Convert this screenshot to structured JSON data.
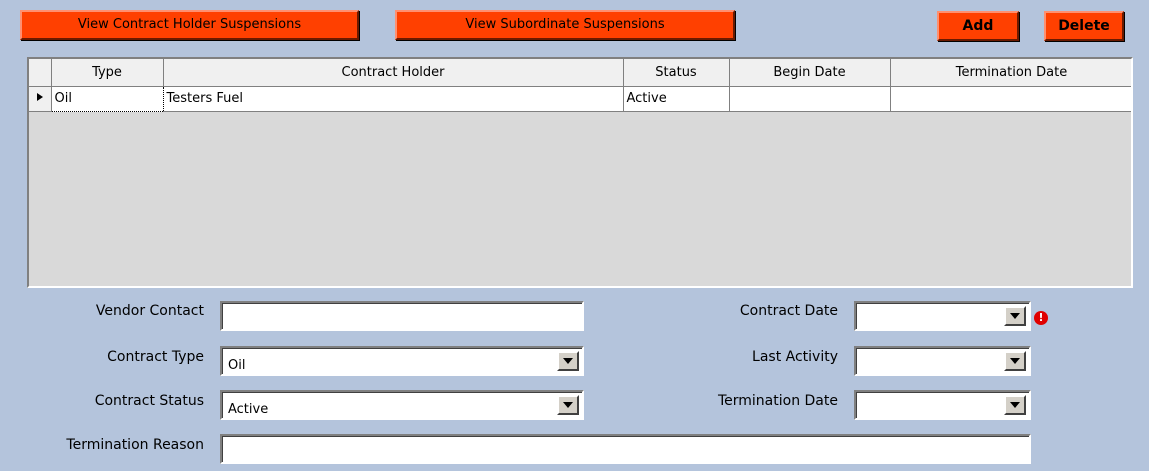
{
  "toolbar": {
    "view_holder_label": "View Contract Holder Suspensions",
    "view_subordinate_label": "View Subordinate Suspensions",
    "add_label": "Add",
    "delete_label": "Delete"
  },
  "colors": {
    "button": "#ff4000",
    "background": "#b4c4dc"
  },
  "grid": {
    "columns": [
      "Type",
      "Contract Holder",
      "Status",
      "Begin Date",
      "Termination Date"
    ],
    "rows": [
      {
        "type": "Oil",
        "contract_holder": "Testers Fuel",
        "status": "Active",
        "begin_date": "",
        "termination_date": ""
      }
    ],
    "row_indicator_icon": "triangle-right-icon"
  },
  "form": {
    "vendor_contact": {
      "label": "Vendor Contact",
      "value": ""
    },
    "contract_type": {
      "label": "Contract Type",
      "value": "Oil"
    },
    "contract_status": {
      "label": "Contract Status",
      "value": "Active"
    },
    "termination_reason": {
      "label": "Termination Reason",
      "value": ""
    },
    "contract_date": {
      "label": "Contract Date",
      "value": "",
      "warning_icon": "exclamation-icon",
      "warning_symbol": "!"
    },
    "last_activity": {
      "label": "Last Activity",
      "value": ""
    },
    "termination_date": {
      "label": "Termination Date",
      "value": ""
    }
  }
}
